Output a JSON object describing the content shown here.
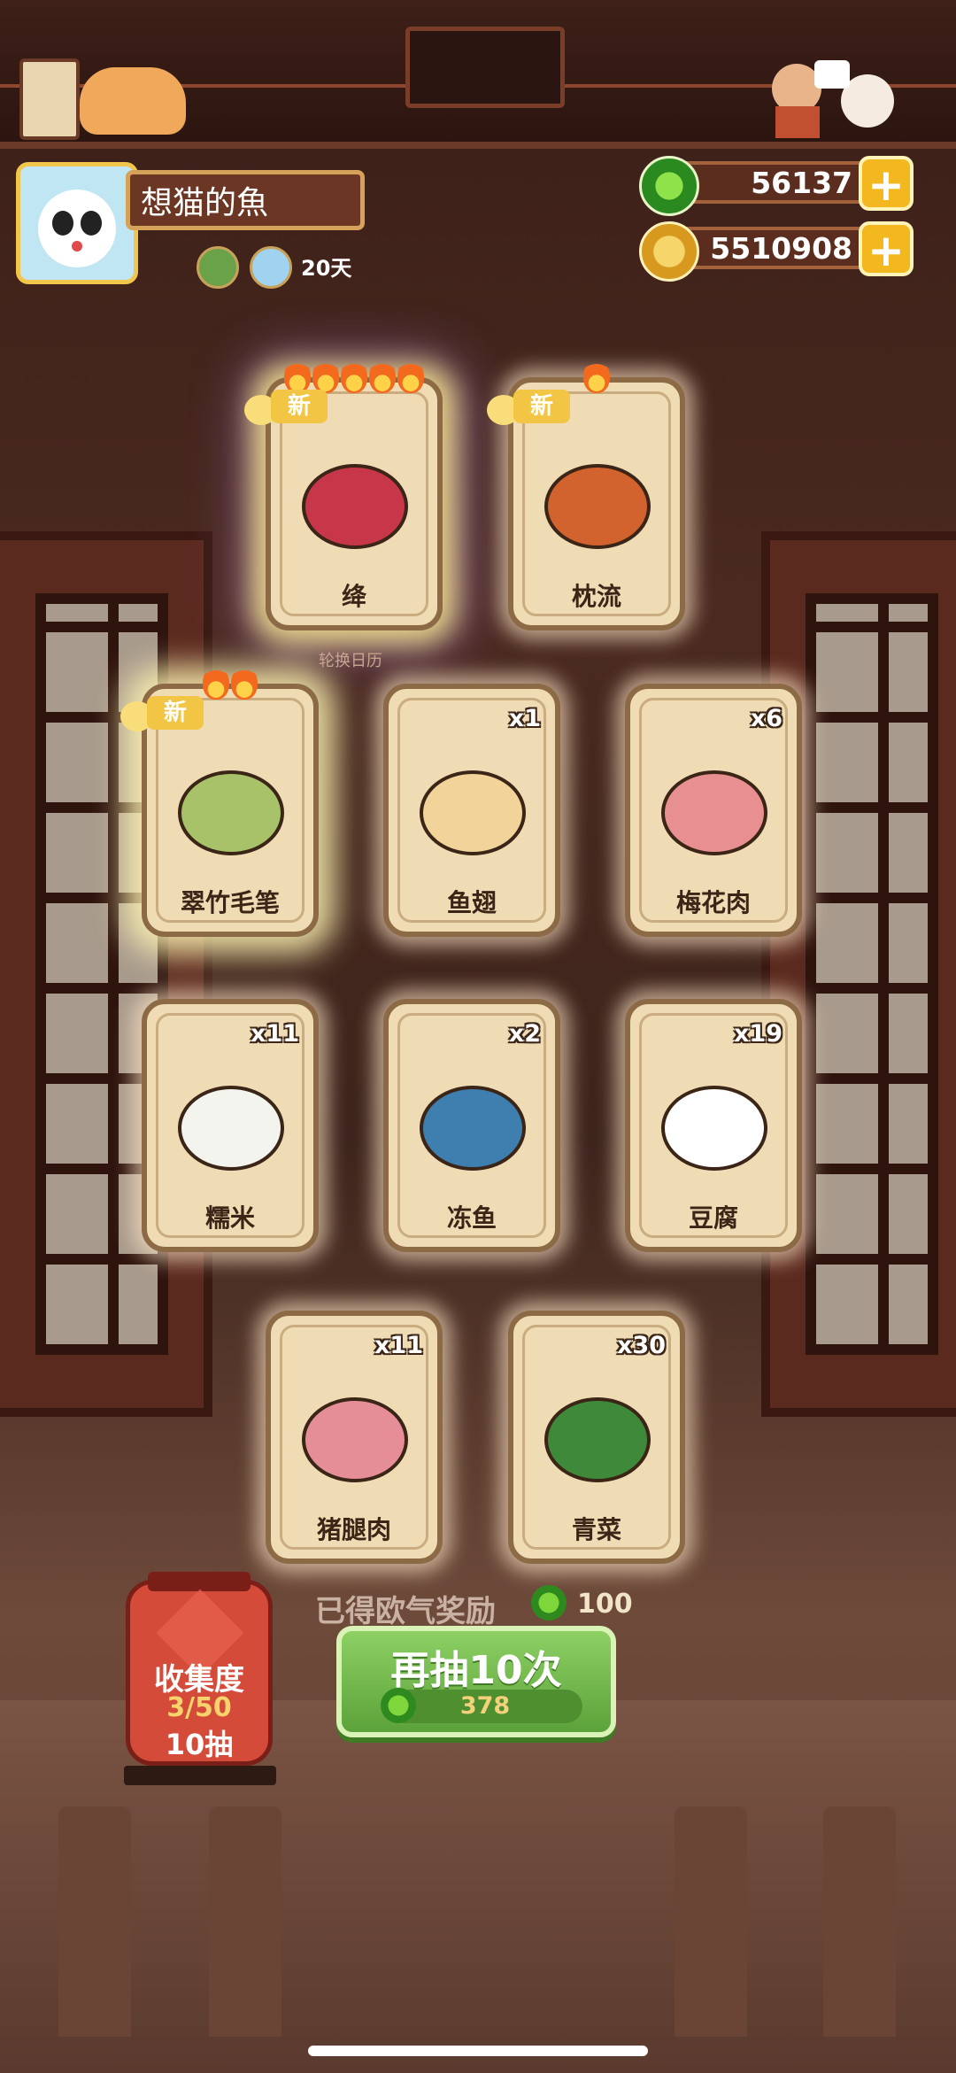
{
  "profile": {
    "name": "想猫的魚",
    "days": "20天"
  },
  "currency": {
    "jade": "56137",
    "coins": "5510908"
  },
  "banner_hint": "轮换日历",
  "cards": [
    {
      "label": "绛",
      "count": "",
      "is_new": true,
      "new_label": "新",
      "flames": 5,
      "glow": "rainbow"
    },
    {
      "label": "枕流",
      "count": "",
      "is_new": true,
      "new_label": "新",
      "flames": 1,
      "glow": "normal"
    },
    {
      "label": "翠竹毛笔",
      "count": "",
      "is_new": true,
      "new_label": "新",
      "flames": 2,
      "glow": "gold"
    },
    {
      "label": "鱼翅",
      "count": "x1",
      "is_new": false,
      "flames": 0,
      "glow": "normal"
    },
    {
      "label": "梅花肉",
      "count": "x6",
      "is_new": false,
      "flames": 0,
      "glow": "normal"
    },
    {
      "label": "糯米",
      "count": "x11",
      "is_new": false,
      "flames": 0,
      "glow": "normal"
    },
    {
      "label": "冻鱼",
      "count": "x2",
      "is_new": false,
      "flames": 0,
      "glow": "normal"
    },
    {
      "label": "豆腐",
      "count": "x19",
      "is_new": false,
      "flames": 0,
      "glow": "normal"
    },
    {
      "label": "猪腿肉",
      "count": "x11",
      "is_new": false,
      "flames": 0,
      "glow": "normal"
    },
    {
      "label": "青菜",
      "count": "x30",
      "is_new": false,
      "flames": 0,
      "glow": "normal"
    }
  ],
  "lucky_reward": {
    "label": "已得欧气奖励",
    "value": "100"
  },
  "collection": {
    "title": "收集度",
    "progress": "3/50",
    "draws": "10抽"
  },
  "draw_button": {
    "label": "再抽10次",
    "cost": "378"
  },
  "colors": {
    "accent_gold": "#f3b81f",
    "button_green": "#6fb847",
    "lantern_red": "#d54b3a",
    "card_bg": "#efdcb4"
  }
}
